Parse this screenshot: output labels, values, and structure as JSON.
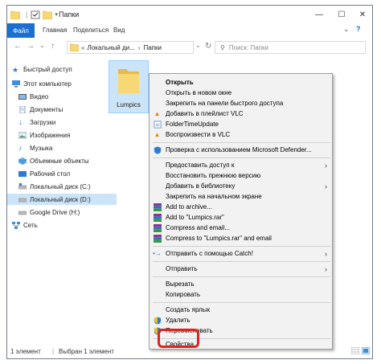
{
  "window": {
    "title": "Папки",
    "controls": {
      "minimize": "—",
      "maximize": "☐",
      "close": "✕"
    }
  },
  "ribbon": {
    "file": "Файл",
    "tabs": [
      "Главная",
      "Поделиться",
      "Вид"
    ],
    "help": "?"
  },
  "nav": {
    "back": "←",
    "forward": "→",
    "recent": "⌄",
    "up": "↑",
    "address": [
      "Локальный ди...",
      "Папки"
    ],
    "address_prefix": "«",
    "address_sep": "›",
    "search_placeholder": "Поиск: Папки"
  },
  "sidebar": {
    "items": [
      {
        "label": "Быстрый доступ",
        "icon": "star-icon"
      },
      {
        "label": "Этот компьютер",
        "icon": "computer-icon"
      },
      {
        "label": "Видео",
        "icon": "video-icon"
      },
      {
        "label": "Документы",
        "icon": "documents-icon"
      },
      {
        "label": "Загрузки",
        "icon": "downloads-icon"
      },
      {
        "label": "Изображения",
        "icon": "pictures-icon"
      },
      {
        "label": "Музыка",
        "icon": "music-icon"
      },
      {
        "label": "Объемные объекты",
        "icon": "3d-objects-icon"
      },
      {
        "label": "Рабочий стол",
        "icon": "desktop-icon"
      },
      {
        "label": "Локальный диск (C:)",
        "icon": "drive-icon"
      },
      {
        "label": "Локальный диск (D:)",
        "icon": "drive-icon"
      },
      {
        "label": "Google Drive (H:)",
        "icon": "drive-icon"
      },
      {
        "label": "Сеть",
        "icon": "network-icon"
      }
    ]
  },
  "folder": {
    "name": "Lumpics"
  },
  "status": {
    "count": "1 элемент",
    "selected": "Выбран 1 элемент"
  },
  "context_menu": {
    "open": "Открыть",
    "open_new_window": "Открыть в новом окне",
    "pin_quick_access": "Закрепить на панели быстрого доступа",
    "add_vlc_playlist": "Добавить в плейлист VLC",
    "folder_time_update": "FolderTimeUpdate",
    "play_vlc": "Воспроизвести в VLC",
    "defender": "Проверка с использованием Microsoft Defender...",
    "give_access": "Предоставить доступ к",
    "restore_version": "Восстановить прежнюю версию",
    "add_library": "Добавить в библиотеку",
    "pin_start": "Закрепить на начальном экране",
    "add_archive": "Add to archive...",
    "add_lumpics_rar": "Add to \"Lumpics.rar\"",
    "compress_email": "Compress and email...",
    "compress_lumpics_email": "Compress to \"Lumpics.rar\" and email",
    "send_catch": "Отправить с помощью Catch!",
    "send_to": "Отправить",
    "cut": "Вырезать",
    "copy": "Копировать",
    "create_shortcut": "Создать ярлык",
    "delete": "Удалить",
    "rename": "Переименовать",
    "properties": "Свойства"
  },
  "colors": {
    "accent": "#1a6fd0",
    "highlight": "#e0221c",
    "selection": "#cce4f7",
    "folder": "#f8d775"
  }
}
